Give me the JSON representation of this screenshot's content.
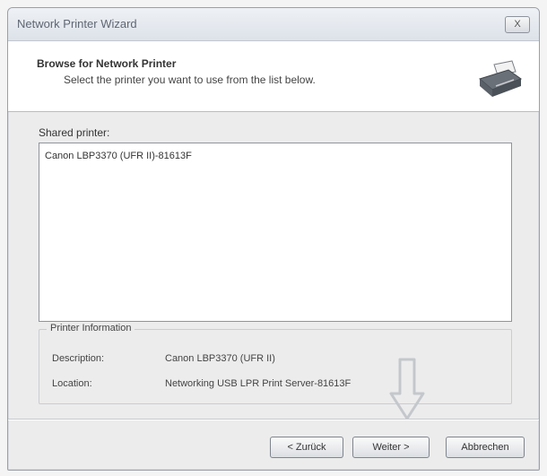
{
  "window": {
    "title": "Network Printer Wizard",
    "close_label": "X"
  },
  "header": {
    "title": "Browse for Network Printer",
    "subtitle": "Select the printer you want to use from the list below."
  },
  "shared_printer": {
    "label": "Shared printer:",
    "items": [
      "Canon LBP3370 (UFR II)-81613F"
    ]
  },
  "printer_information": {
    "title": "Printer Information",
    "description_label": "Description:",
    "description_value": "Canon LBP3370 (UFR II)",
    "location_label": "Location:",
    "location_value": "Networking USB LPR Print Server-81613F"
  },
  "buttons": {
    "back": "< Zurück",
    "next": "Weiter >",
    "cancel": "Abbrechen"
  },
  "icons": {
    "printer": "printer-icon",
    "hint_arrow": "down-arrow-icon"
  }
}
